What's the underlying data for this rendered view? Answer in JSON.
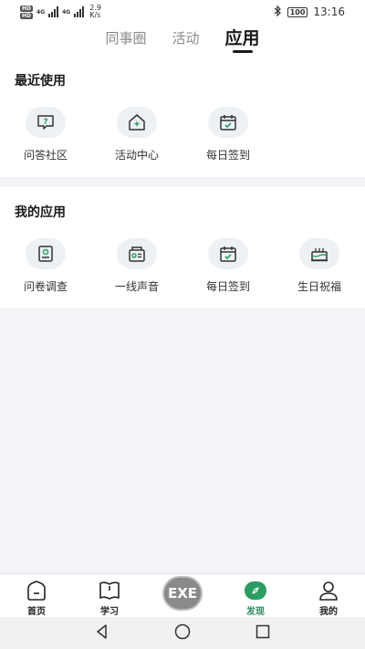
{
  "status_bar": {
    "sim1": "HD",
    "sim2": "HD",
    "network_type": "4G",
    "network_type2": "4G",
    "speed_value": "2.9",
    "speed_unit": "K/s",
    "battery": "100",
    "time": "13:16"
  },
  "top_tabs": {
    "tab1": "同事圈",
    "tab2": "活动",
    "tab3": "应用"
  },
  "recent": {
    "title": "最近使用",
    "items": [
      {
        "label": "问答社区",
        "icon": "qa-icon"
      },
      {
        "label": "活动中心",
        "icon": "activity-house-icon"
      },
      {
        "label": "每日签到",
        "icon": "calendar-check-icon"
      }
    ]
  },
  "mine": {
    "title": "我的应用",
    "items": [
      {
        "label": "问卷调查",
        "icon": "survey-icon"
      },
      {
        "label": "一线声音",
        "icon": "voice-radio-icon"
      },
      {
        "label": "每日签到",
        "icon": "calendar-check-icon"
      },
      {
        "label": "生日祝福",
        "icon": "birthday-cake-icon"
      }
    ]
  },
  "bottom_nav": {
    "home": "首页",
    "study": "学习",
    "center": "EXE",
    "discover": "发现",
    "mine": "我的"
  },
  "colors": {
    "accent_green": "#2a9d62",
    "active_label": "#2a8a5c"
  }
}
